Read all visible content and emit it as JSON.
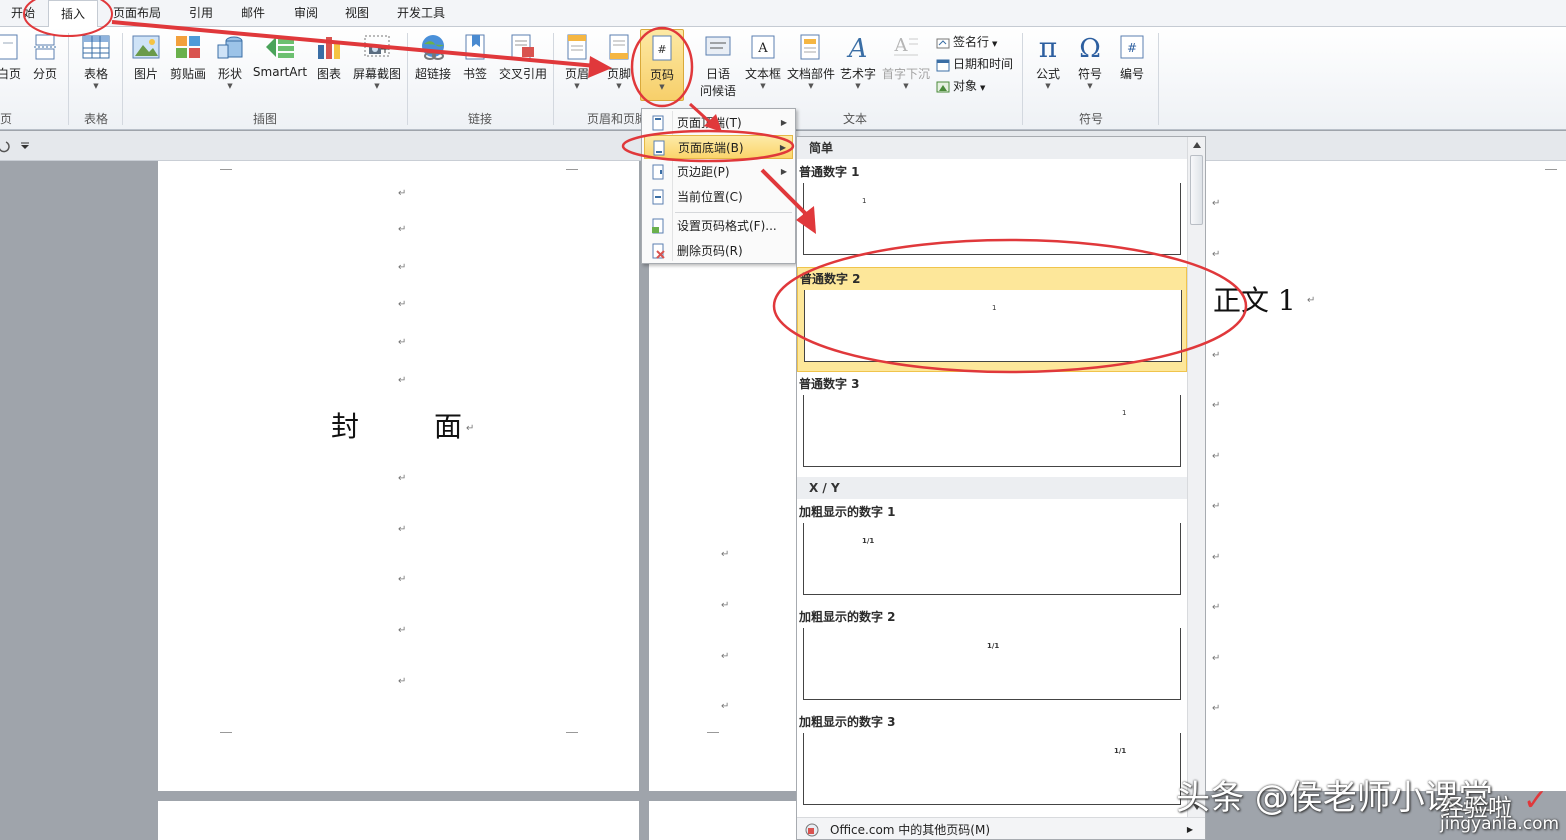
{
  "tabs": [
    {
      "label": "开始"
    },
    {
      "label": "插入",
      "active": true
    },
    {
      "label": "页面布局"
    },
    {
      "label": "引用"
    },
    {
      "label": "邮件"
    },
    {
      "label": "审阅"
    },
    {
      "label": "视图"
    },
    {
      "label": "开发工具"
    }
  ],
  "ribbon": {
    "pages": {
      "blank_page": "白页",
      "page_break": "分页",
      "group": "页"
    },
    "tables": {
      "table": "表格",
      "group": "表格"
    },
    "illustrations": {
      "picture": "图片",
      "clipart": "剪贴画",
      "shapes": "形状",
      "smartart": "SmartArt",
      "chart": "图表",
      "screenshot": "屏幕截图",
      "group": "插图"
    },
    "links": {
      "hyperlink": "超链接",
      "bookmark": "书签",
      "crossref": "交叉引用",
      "group": "链接"
    },
    "header_footer": {
      "header": "页眉",
      "footer": "页脚",
      "page_number": "页码",
      "group": "页眉和页脚"
    },
    "text": {
      "greeting_1": "日语",
      "greeting_2": "问候语",
      "textbox": "文本框",
      "quickparts": "文档部件",
      "wordart": "艺术字",
      "dropcap": "首字下沉",
      "signature": "签名行",
      "datetime": "日期和时间",
      "object": "对象",
      "group": "文本"
    },
    "symbols": {
      "equation": "公式",
      "symbol": "符号",
      "number": "编号",
      "group": "符号"
    },
    "glyphs": {
      "equation": "π",
      "symbol": "Ω",
      "number": "#",
      "textbox": "A",
      "page_number": "#"
    }
  },
  "page_number_menu": {
    "items": [
      {
        "label": "页面顶端(T)",
        "submenu": true
      },
      {
        "label": "页面底端(B)",
        "submenu": true,
        "highlighted": true
      },
      {
        "label": "页边距(P)",
        "submenu": true
      },
      {
        "label": "当前位置(C)",
        "submenu": true
      },
      {
        "label": "设置页码格式(F)..."
      },
      {
        "label": "删除页码(R)"
      }
    ]
  },
  "gallery": {
    "categories": [
      "简单",
      "X / Y"
    ],
    "items": [
      {
        "name": "普通数字 1",
        "preview": "1",
        "align": "left"
      },
      {
        "name": "普通数字 2",
        "preview": "1",
        "align": "center",
        "highlighted": true
      },
      {
        "name": "普通数字 3",
        "preview": "1",
        "align": "right"
      },
      {
        "name": "加粗显示的数字 1",
        "preview": "1/1",
        "align": "left"
      },
      {
        "name": "加粗显示的数字 2",
        "preview": "1/1",
        "align": "center"
      },
      {
        "name": "加粗显示的数字 3",
        "preview": "1/1",
        "align": "right"
      }
    ],
    "footer": "Office.com 中的其他页码(M)"
  },
  "document": {
    "cover_text_1": "封",
    "cover_text_2": "面",
    "body_text": "正文 1",
    "para_mark": "↵"
  },
  "watermark": {
    "author": "头条 @侯老师小课堂",
    "site_title": "经验啦",
    "site_url": "jingyanla.com",
    "check": "✓"
  },
  "colors": {
    "annotation_red": "#e0383b",
    "menu_highlight": "#fbd56b",
    "gallery_highlight": "#fde79a"
  }
}
